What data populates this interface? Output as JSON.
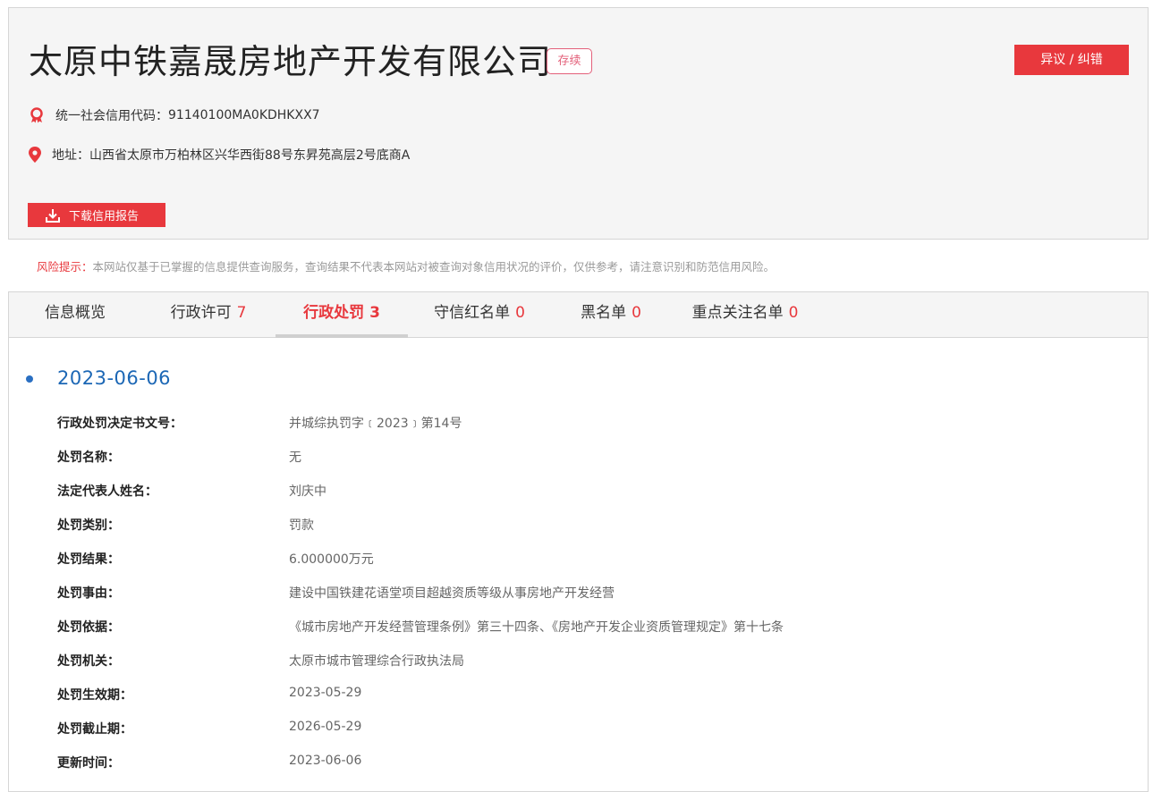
{
  "header": {
    "company_name": "太原中铁嘉晟房地产开发有限公司",
    "status": "存续",
    "dispute_label": "异议 / 纠错",
    "credit_code_label": "统一社会信用代码：",
    "credit_code": "91140100MA0KDHKXX7",
    "address_label": "地址：",
    "address": "山西省太原市万柏林区兴华西街88号东昇苑高层2号底商A",
    "download_label": "下载信用报告"
  },
  "risk": {
    "label": "风险提示：",
    "text": "本网站仅基于已掌握的信息提供查询服务，查询结果不代表本网站对被查询对象信用状况的评价，仅供参考，请注意识别和防范信用风险。"
  },
  "tabs": [
    {
      "label": "信息概览",
      "count": ""
    },
    {
      "label": "行政许可",
      "count": "7"
    },
    {
      "label": "行政处罚",
      "count": "3",
      "active": true
    },
    {
      "label": "守信红名单",
      "count": "0"
    },
    {
      "label": "黑名单",
      "count": "0"
    },
    {
      "label": "重点关注名单",
      "count": "0"
    }
  ],
  "record": {
    "date": "2023-06-06",
    "fields": [
      {
        "label": "行政处罚决定书文号：",
        "value": "并城综执罚字﹝2023﹞第14号"
      },
      {
        "label": "处罚名称：",
        "value": "无"
      },
      {
        "label": "法定代表人姓名：",
        "value": "刘庆中"
      },
      {
        "label": "处罚类别：",
        "value": "罚款"
      },
      {
        "label": "处罚结果：",
        "value": "6.000000万元"
      },
      {
        "label": "处罚事由：",
        "value": "建设中国铁建花语堂项目超越资质等级从事房地产开发经营"
      },
      {
        "label": "处罚依据：",
        "value": "《城市房地产开发经营管理条例》第三十四条、《房地产开发企业资质管理规定》第十七条"
      },
      {
        "label": "处罚机关：",
        "value": "太原市城市管理综合行政执法局"
      },
      {
        "label": "处罚生效期：",
        "value": "2023-05-29"
      },
      {
        "label": "处罚截止期：",
        "value": "2026-05-29"
      },
      {
        "label": "更新时间：",
        "value": "2023-06-06"
      }
    ]
  },
  "colors": {
    "accent": "#e8383d",
    "date_blue": "#1c67b5",
    "badge": "#e3607a"
  },
  "icons": {
    "credit": "ribbon-badge-icon",
    "address": "location-pin-icon",
    "download": "download-icon"
  }
}
